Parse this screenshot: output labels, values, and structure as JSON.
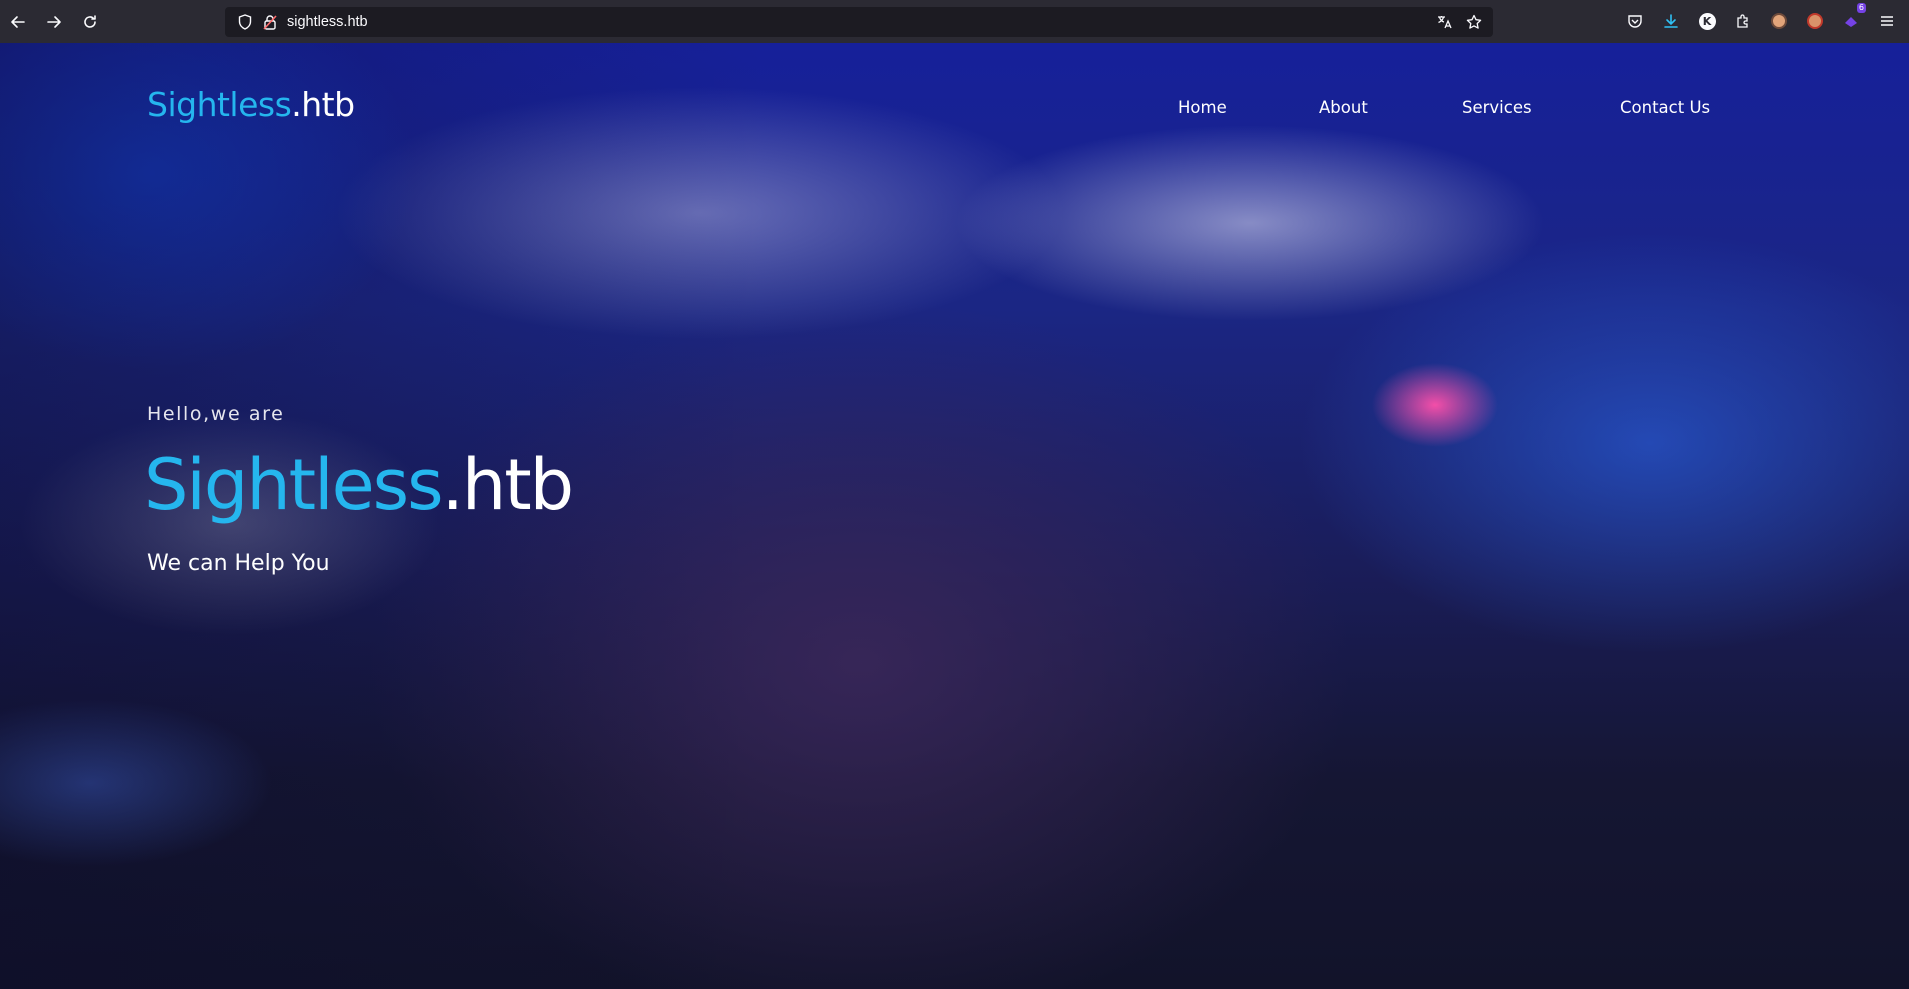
{
  "browser": {
    "url": "sightless.htb",
    "extension_badge_count": "6",
    "profile_initial": "K"
  },
  "site": {
    "logo": {
      "brand": "Sightless",
      "tld": ".htb"
    },
    "nav": [
      "Home",
      "About",
      "Services",
      "Contact Us"
    ],
    "hero": {
      "greeting": "Hello,we are",
      "title_brand": "Sightless",
      "title_tld": ".htb",
      "subtitle": "We can Help You"
    }
  },
  "colors": {
    "accent": "#25b6ee",
    "chrome_toolbar": "#2b2a33",
    "urlbar_bg": "#1c1b22"
  },
  "icons": {
    "back": "arrow-left",
    "forward": "arrow-right",
    "reload": "reload",
    "tracking": "shield",
    "connection": "lock-warning",
    "translate": "translate",
    "bookmark": "star",
    "pocket": "pocket",
    "downloads": "download",
    "extensions": "puzzle",
    "menu": "hamburger"
  }
}
